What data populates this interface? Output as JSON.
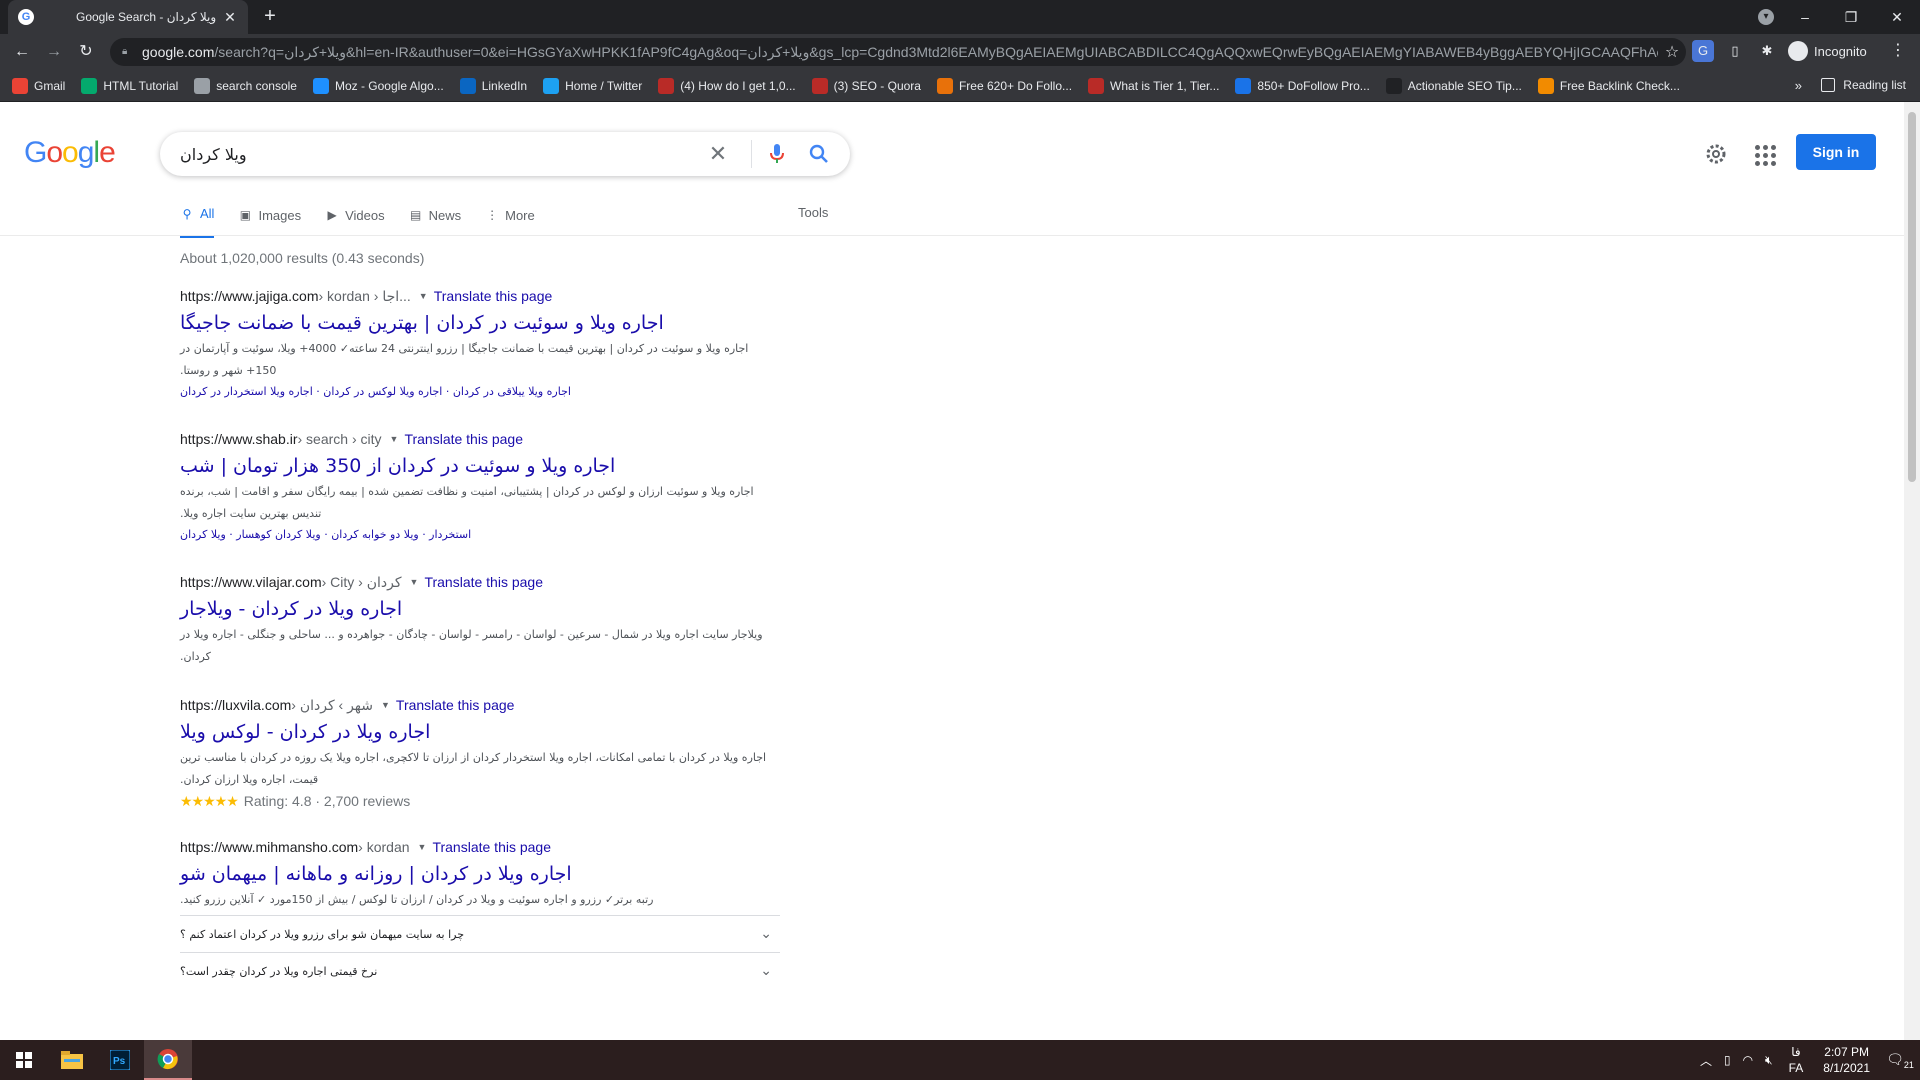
{
  "browser": {
    "tab_title": "Google Search - ویلا کردان",
    "url_host": "google.com",
    "url_rest": "/search?q=ویلا+کردان&hl=en-IR&authuser=0&ei=HGsGYaXwHPKK1fAP9fC4gAg&oq=ویلا+کردان&gs_lcp=Cgdnd3Mtd2l6EAMyBQgAEIAEMgUIABCABDILCC4QgAQQxwEQrwEyBQgAEIAEMgYIABAWEB4yBggAEBYQHjIGCAAQFhAeM...",
    "incognito_label": "Incognito",
    "reading_list": "Reading list",
    "bookmarks": [
      {
        "label": "Gmail",
        "icon": "gmail-icon",
        "color": "#ea4335"
      },
      {
        "label": "HTML Tutorial",
        "icon": "w3schools-icon",
        "color": "#04aa6d"
      },
      {
        "label": "search console",
        "icon": "search-console-icon",
        "color": "#9aa0a6"
      },
      {
        "label": "Moz - Google Algo...",
        "icon": "moz-icon",
        "color": "#1e90ff"
      },
      {
        "label": "LinkedIn",
        "icon": "linkedin-icon",
        "color": "#0a66c2"
      },
      {
        "label": "Home / Twitter",
        "icon": "twitter-icon",
        "color": "#1da1f2"
      },
      {
        "label": "(4) How do I get 1,0...",
        "icon": "quora-icon",
        "color": "#b92b27"
      },
      {
        "label": "(3) SEO - Quora",
        "icon": "quora-icon",
        "color": "#b92b27"
      },
      {
        "label": "Free 620+ Do Follo...",
        "icon": "dofollow-icon",
        "color": "#e8710a"
      },
      {
        "label": "What is Tier 1, Tier...",
        "icon": "quora-icon",
        "color": "#b92b27"
      },
      {
        "label": "850+ DoFollow Pro...",
        "icon": "image-icon",
        "color": "#1a73e8"
      },
      {
        "label": "Actionable SEO Tip...",
        "icon": "seo-icon",
        "color": "#202124"
      },
      {
        "label": "Free Backlink Check...",
        "icon": "ahrefs-icon",
        "color": "#f28b00"
      }
    ]
  },
  "search": {
    "query": "ویلا کردان",
    "sign_in": "Sign in",
    "tabs": [
      {
        "label": "All",
        "icon": "search-icon",
        "active": true
      },
      {
        "label": "Images",
        "icon": "image-icon",
        "active": false
      },
      {
        "label": "Videos",
        "icon": "video-icon",
        "active": false
      },
      {
        "label": "News",
        "icon": "news-icon",
        "active": false
      },
      {
        "label": "More",
        "icon": "more-vert-icon",
        "active": false
      }
    ],
    "tools": "Tools",
    "stats": "About 1,020,000 results (0.43 seconds)"
  },
  "results": [
    {
      "url": "https://www.jajiga.com",
      "crumbs": " › kordan › اجا...",
      "translate": "Translate this page",
      "title": "اجاره ویلا و سوئیت در کردان | بهترین قیمت با ضمانت جاجیگا",
      "snippet": "اجاره ویلا و سوئیت در کردان | بهترین قیمت با ضمانت جاجیگا | رزرو اینترنتی 24 ساعته✓ 4000+ ویلا، سوئیت و آپارتمان در 150+ شهر و روستا.",
      "sitelinks": "اجاره ویلا ییلاقی در کردان · اجاره ویلا لوکس در کردان · اجاره ویلا استخردار در کردان"
    },
    {
      "url": "https://www.shab.ir",
      "crumbs": " › search › city",
      "translate": "Translate this page",
      "title": "اجاره ویلا و سوئیت در کردان از 350 هزار تومان | شب",
      "snippet": "اجاره ویلا و سوئیت ارزان و لوکس در کردان | پشتیبانی، امنیت و نظافت تضمین شده | بیمه رایگان سفر و اقامت | شب، برنده تندیس بهترین سایت اجاره ویلا.",
      "sitelinks": "استخردار · ویلا دو خوابه کردان · ویلا کردان کوهسار · ویلا کردان"
    },
    {
      "url": "https://www.vilajar.com",
      "crumbs": " › City › کردان",
      "translate": "Translate this page",
      "title": "اجاره ویلا در کردان - ویلاجار",
      "snippet": "ویلاجار سایت اجاره ویلا در شمال - سرعین - لواسان - رامسر - لواسان - چادگان - جواهرده و ... ساحلی و جنگلی - اجاره ویلا در کردان.",
      "sitelinks": ""
    },
    {
      "url": "https://luxvila.com",
      "crumbs": " › شهر › کردان",
      "translate": "Translate this page",
      "title": "اجاره ویلا در کردان - لوکس ویلا",
      "snippet": "اجاره ویلا در کردان با تمامی امکانات، اجاره ویلا استخردار کردان از ارزان تا لاکچری، اجاره ویلا یک روزه در کردان با مناسب ترین قیمت، اجاره ویلا ارزان کردان.",
      "sitelinks": "",
      "rating": "Rating: 4.8 · 2,700 reviews",
      "stars": "★★★★★"
    },
    {
      "url": "https://www.mihmansho.com",
      "crumbs": " › kordan",
      "translate": "Translate this page",
      "title": "اجاره ویلا در کردان | روزانه و ماهانه | میهمان شو",
      "snippet": "رتبه برتر✓ رزرو و اجاره سوئیت و ویلا در کردان / ارزان تا لوکس / بیش از 150مورد ✓ آنلاین رزرو کنید.",
      "sitelinks": "",
      "faqs": [
        "چرا به سایت میهمان شو برای رزرو ویلا در کردان اعتماد کنم ؟",
        "نرخ قیمتی اجاره ویلا در کردان چقدر است؟"
      ]
    }
  ],
  "taskbar": {
    "time": "2:07 PM",
    "date": "8/1/2021",
    "lang_top": "فا",
    "lang_bottom": "FA",
    "notifications": "21"
  }
}
